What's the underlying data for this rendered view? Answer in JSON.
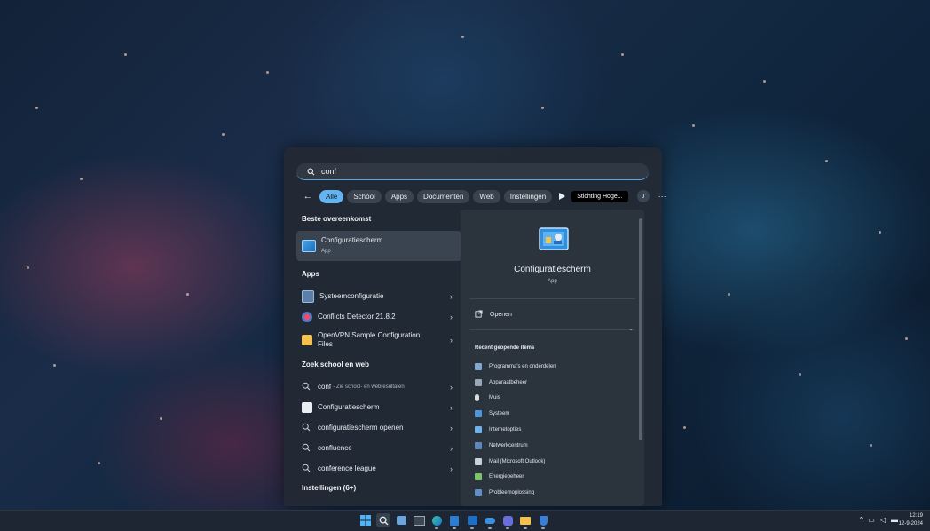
{
  "search": {
    "value": "conf"
  },
  "tabs": [
    "Alle",
    "School",
    "Apps",
    "Documenten",
    "Web",
    "Instellingen"
  ],
  "org_badge": "Stichting Hoge...",
  "avatar_letter": "J",
  "more_label": "···",
  "sections": {
    "best_match": "Beste overeenkomst",
    "apps": "Apps",
    "web": "Zoek school en web",
    "settings": "Instellingen (6+)"
  },
  "best_match": {
    "title": "Configuratiescherm",
    "sub": "App"
  },
  "apps": [
    {
      "label": "Systeemconfiguratie",
      "icon": "system-config-icon"
    },
    {
      "label": "Conflicts Detector 21.8.2",
      "icon": "conflicts-icon"
    },
    {
      "label": "OpenVPN Sample Configuration Files",
      "icon": "folder-icon"
    }
  ],
  "web": {
    "first_query": "conf",
    "first_hint": "- Zie school- en webresultaten",
    "items": [
      {
        "label": "Configuratiescherm",
        "icon": "control-panel-icon"
      },
      {
        "label": "configuratiescherm openen",
        "icon": "search-icon"
      },
      {
        "label": "confluence",
        "icon": "search-icon"
      },
      {
        "label": "conference league",
        "icon": "search-icon"
      }
    ]
  },
  "preview": {
    "title": "Configuratiescherm",
    "sub": "App",
    "open_label": "Openen",
    "recent_head": "Recent geopende items",
    "recent": [
      "Programma's en onderdelen",
      "Apparaatbeheer",
      "Muis",
      "Systeem",
      "Internetopties",
      "Netwerkcentrum",
      "Mail (Microsoft Outlook)",
      "Energiebeheer",
      "Probleemoplossing"
    ]
  },
  "clock": {
    "time": "12:19",
    "date": "12-9-2024"
  },
  "colors": {
    "accent": "#63b4f0",
    "panel": "#222a34"
  }
}
